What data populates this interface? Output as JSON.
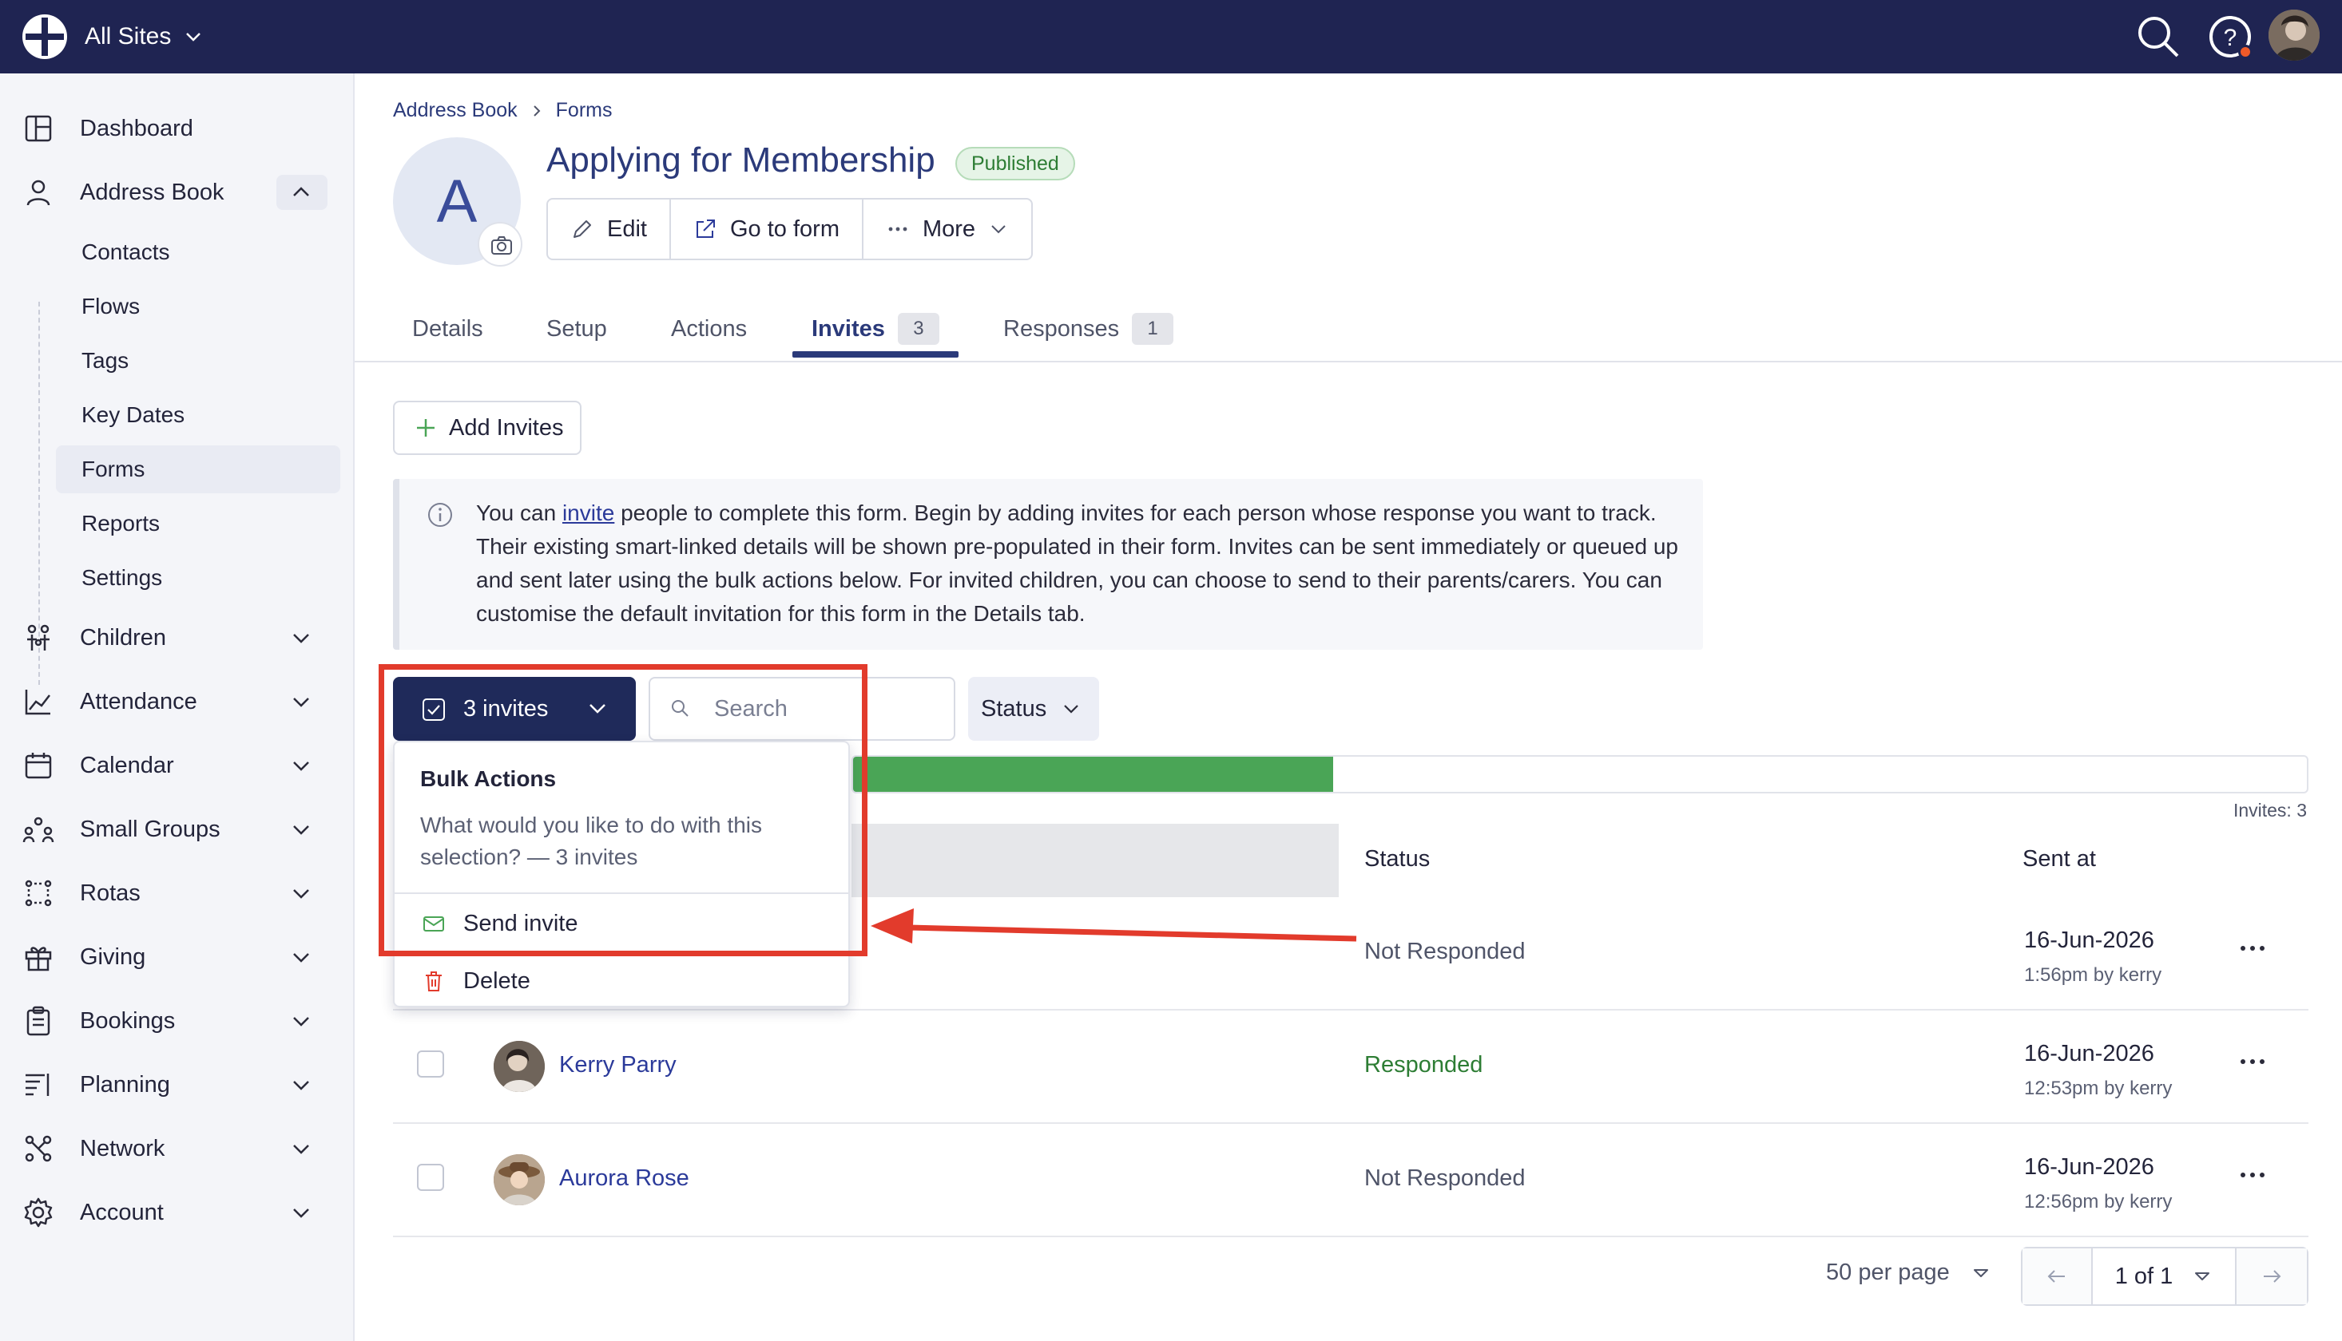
{
  "topbar": {
    "site_switcher": "All Sites",
    "icons": [
      "logo-icon",
      "search-icon",
      "help-icon",
      "user-avatar"
    ]
  },
  "sidebar": {
    "items": [
      {
        "label": "Dashboard",
        "icon": "dashboard-icon"
      },
      {
        "label": "Address Book",
        "icon": "person-icon",
        "expanded": true
      },
      {
        "label": "Children",
        "icon": "children-icon"
      },
      {
        "label": "Attendance",
        "icon": "chart-icon"
      },
      {
        "label": "Calendar",
        "icon": "calendar-icon"
      },
      {
        "label": "Small Groups",
        "icon": "groups-icon"
      },
      {
        "label": "Rotas",
        "icon": "rotas-icon"
      },
      {
        "label": "Giving",
        "icon": "gift-icon"
      },
      {
        "label": "Bookings",
        "icon": "clipboard-icon"
      },
      {
        "label": "Planning",
        "icon": "planning-icon"
      },
      {
        "label": "Network",
        "icon": "network-icon"
      },
      {
        "label": "Account",
        "icon": "gear-icon"
      }
    ],
    "sub_items": [
      "Contacts",
      "Flows",
      "Tags",
      "Key Dates",
      "Forms",
      "Reports",
      "Settings"
    ],
    "active_sub": "Forms"
  },
  "breadcrumb": [
    "Address Book",
    "Forms"
  ],
  "form": {
    "avatar_letter": "A",
    "title": "Applying for Membership",
    "status_badge": "Published"
  },
  "actions": {
    "edit": "Edit",
    "go_to_form": "Go to form",
    "more": "More"
  },
  "tabs": [
    {
      "label": "Details"
    },
    {
      "label": "Setup"
    },
    {
      "label": "Actions"
    },
    {
      "label": "Invites",
      "count": "3",
      "active": true
    },
    {
      "label": "Responses",
      "count": "1"
    }
  ],
  "add_invites_label": "Add Invites",
  "info": {
    "prefix": "You can ",
    "link": "invite",
    "text": " people to complete this form. Begin by adding invites for each person whose response you want to track. Their existing smart-linked details will be shown pre-populated in their form. Invites can be sent immediately or queued up and sent later using the bulk actions below. For invited children, you can choose to send to their parents/carers. You can customise the default invitation for this form in the Details tab."
  },
  "toolbar": {
    "bulk_button": "3 invites",
    "search_placeholder": "Search",
    "status_filter": "Status"
  },
  "progress": {
    "responded_fraction": 0.33,
    "count_label": "Invites: 3"
  },
  "table": {
    "headers": {
      "status": "Status",
      "sent_at": "Sent at"
    },
    "rows": [
      {
        "name": "",
        "status": "Not Responded",
        "date": "16-Jun-2026",
        "by": "1:56pm by kerry"
      },
      {
        "name": "Kerry Parry",
        "status": "Responded",
        "date": "16-Jun-2026",
        "by": "12:53pm by kerry"
      },
      {
        "name": "Aurora Rose",
        "status": "Not Responded",
        "date": "16-Jun-2026",
        "by": "12:56pm by kerry"
      }
    ]
  },
  "bulk_menu": {
    "title": "Bulk Actions",
    "description": "What would you like to do with this selection? — 3 invites",
    "send_invite": "Send invite",
    "delete": "Delete"
  },
  "pagination": {
    "per_page": "50 per page",
    "page": "1 of 1"
  },
  "colors": {
    "topbar": "#1f2452",
    "accent": "#2b3a7a",
    "success": "#4aa556",
    "danger": "#e23b2c"
  }
}
